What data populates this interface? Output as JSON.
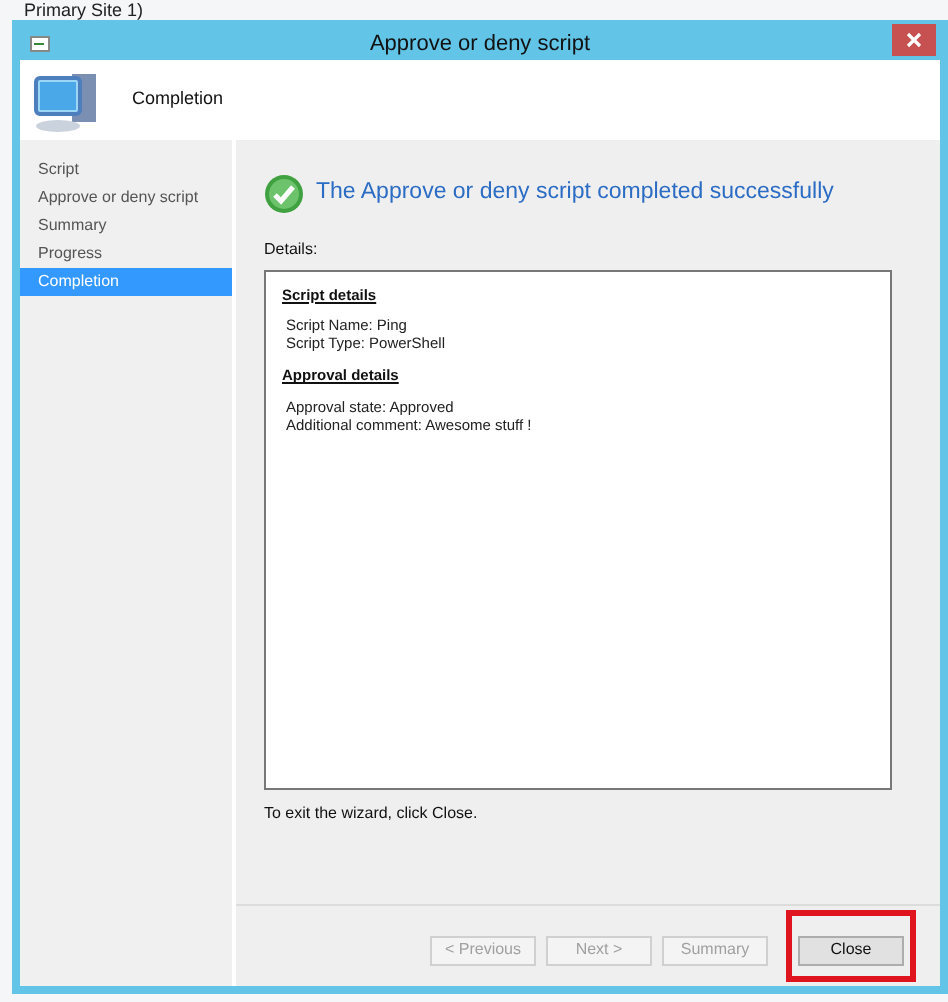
{
  "background": {
    "title": "Primary Site 1)"
  },
  "window": {
    "title": "Approve or deny script"
  },
  "header": {
    "title": "Completion"
  },
  "steps": [
    {
      "label": "Script",
      "selected": false
    },
    {
      "label": "Approve or deny script",
      "selected": false
    },
    {
      "label": "Summary",
      "selected": false
    },
    {
      "label": "Progress",
      "selected": false
    },
    {
      "label": "Completion",
      "selected": true
    }
  ],
  "status_message": "The Approve or deny script completed successfully",
  "details_label": "Details:",
  "details": [
    {
      "heading": "Script details",
      "lines": [
        "Script Name: Ping",
        "Script Type: PowerShell"
      ]
    },
    {
      "heading": "Approval details",
      "lines": [
        "Approval state: Approved",
        "Additional comment: Awesome stuff !"
      ]
    }
  ],
  "exit_hint": "To exit the wizard, click Close.",
  "buttons": [
    {
      "label": "< Previous",
      "disabled": true,
      "highlighted": false
    },
    {
      "label": "Next >",
      "disabled": true,
      "highlighted": false
    },
    {
      "label": "Summary",
      "disabled": true,
      "highlighted": false
    },
    {
      "label": "Close",
      "disabled": false,
      "highlighted": true
    }
  ]
}
